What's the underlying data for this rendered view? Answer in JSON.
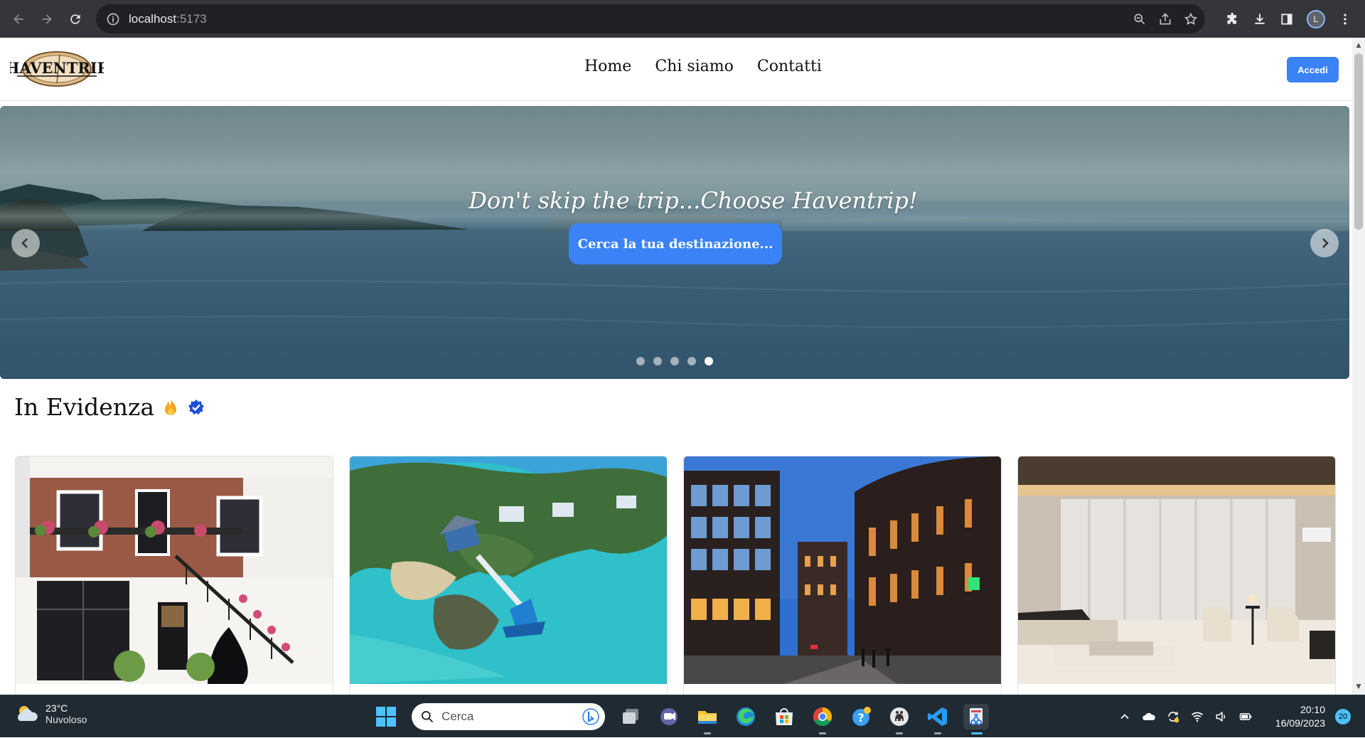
{
  "browser": {
    "url_host": "localhost",
    "url_port": ":5173"
  },
  "navbar": {
    "logo_text": "HAVENTRIP",
    "menu": [
      "Home",
      "Chi siamo",
      "Contatti"
    ],
    "login_label": "Accedi"
  },
  "hero": {
    "title": "Don't skip the trip...Choose Haventrip!",
    "cta_label": "Cerca la tua destinazione...",
    "slide_count": 5,
    "active_slide": 5
  },
  "featured": {
    "title": "In Evidenza",
    "icons": [
      "fire-icon",
      "verified-badge-icon"
    ],
    "cards": [
      {
        "image": "brick-townhouse-photo"
      },
      {
        "image": "tropical-island-aerial-photo"
      },
      {
        "image": "city-buildings-dusk-photo"
      },
      {
        "image": "modern-living-room-photo"
      }
    ]
  },
  "taskbar": {
    "weather_temp": "23°C",
    "weather_desc": "Nuvoloso",
    "search_placeholder": "Cerca",
    "time": "20:10",
    "date": "16/09/2023",
    "notification_count": "20"
  }
}
